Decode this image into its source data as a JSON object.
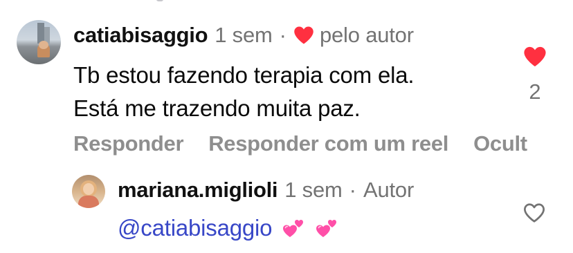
{
  "comment": {
    "username": "catiabisaggio",
    "time": "1 sem",
    "separator": "·",
    "by_author": "pelo autor",
    "text_lines": [
      "Tb estou fazendo terapia com ela.",
      "Está me trazendo muita paz."
    ],
    "like_count": "2",
    "liked": true,
    "actions": {
      "reply": "Responder",
      "reply_with_reel": "Responder com um reel",
      "hide": "Ocult"
    }
  },
  "reply": {
    "username": "mariana.miglioli",
    "time": "1 sem",
    "separator": "·",
    "badge": "Autor",
    "mention": "@catiabisaggio",
    "emojis": [
      "two-hearts",
      "two-hearts"
    ],
    "liked": false
  },
  "colors": {
    "heart_red": "#ff3040",
    "mention_blue": "#3847c7",
    "muted_gray": "#737373",
    "action_gray": "#8e8e8e",
    "emoji_pink": "#ff4fa8"
  }
}
